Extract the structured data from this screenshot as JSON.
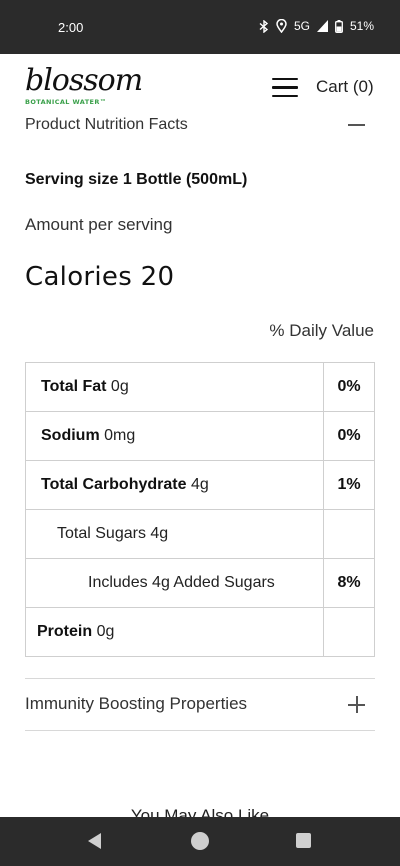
{
  "status_bar": {
    "time": "2:00",
    "network": "5G",
    "battery": "51%"
  },
  "header": {
    "logo_text": "blossom",
    "logo_subtext": "BOTANICAL WATER™",
    "cart_label": "Cart (0)"
  },
  "nutrition": {
    "section_title": "Product Nutrition Facts",
    "serving_size": "Serving size 1 Bottle (500mL)",
    "amount_per_serving": "Amount per serving",
    "calories": "Calories 20",
    "daily_value_header": "% Daily Value",
    "rows": [
      {
        "name": "Total Fat",
        "amount": " 0g",
        "dv": "0%"
      },
      {
        "name": "Sodium",
        "amount": " 0mg",
        "dv": "0%"
      },
      {
        "name": "Total Carbohydrate",
        "amount": " 4g",
        "dv": "1%"
      },
      {
        "name": "Total Sugars 4g",
        "amount": "",
        "dv": ""
      },
      {
        "name": "Includes 4g Added Sugars",
        "amount": "",
        "dv": "8%"
      },
      {
        "name": "Protein",
        "amount": " 0g",
        "dv": ""
      }
    ]
  },
  "immunity": {
    "title": "Immunity Boosting Properties"
  },
  "also_like": {
    "title": "You May Also Like"
  }
}
